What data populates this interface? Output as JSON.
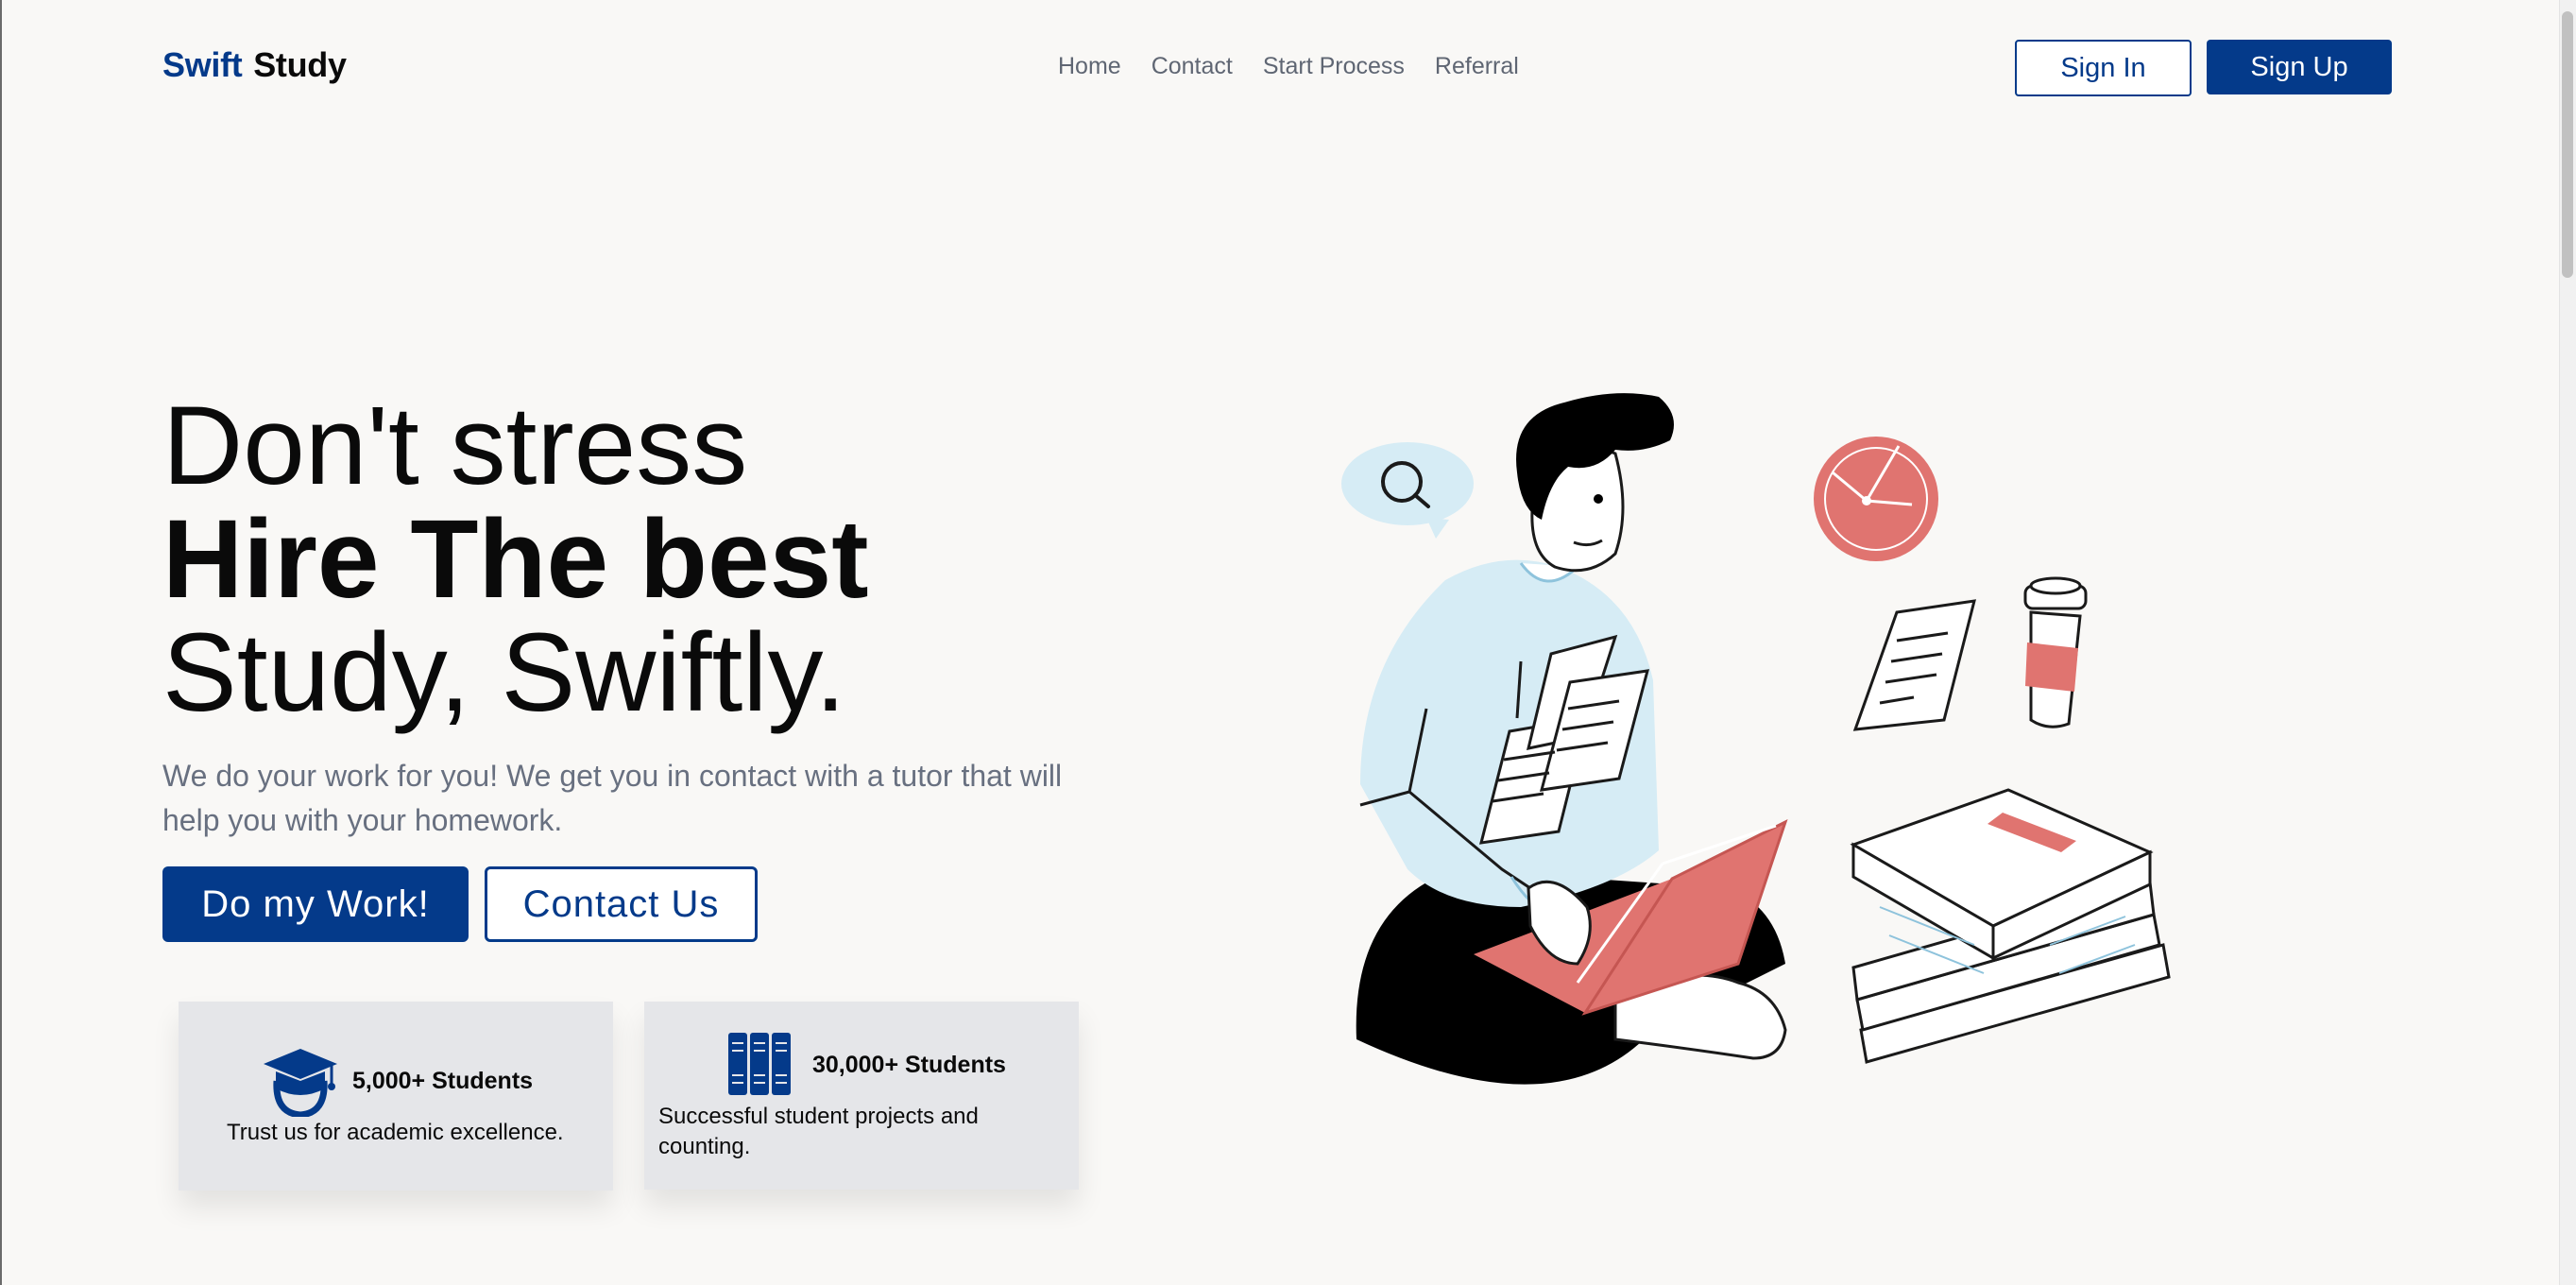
{
  "brand": {
    "part1": "Swift",
    "part2": "Study"
  },
  "nav": {
    "items": [
      {
        "label": "Home"
      },
      {
        "label": "Contact"
      },
      {
        "label": "Start Process"
      },
      {
        "label": "Referral"
      }
    ]
  },
  "auth": {
    "sign_in": "Sign In",
    "sign_up": "Sign Up"
  },
  "hero": {
    "line1": "Don't stress",
    "line2": "Hire The best",
    "line3": "Study, Swiftly.",
    "subtext": "We do your work for you! We get you in contact with a tutor that will help you with your homework.",
    "primary_cta": "Do my Work!",
    "secondary_cta": "Contact Us"
  },
  "stats": [
    {
      "icon": "graduation-cap-icon",
      "title": "5,000+ Students",
      "desc": "Trust us for academic excellence."
    },
    {
      "icon": "books-icon",
      "title": "30,000+ Students",
      "desc": "Successful student projects and counting."
    }
  ],
  "colors": {
    "brand": "#043a8a",
    "background": "#f9f8f6",
    "accent": "#e07470",
    "sweater": "#d6ecf5",
    "card": "#e5e6e9",
    "muted_text": "#687080"
  }
}
